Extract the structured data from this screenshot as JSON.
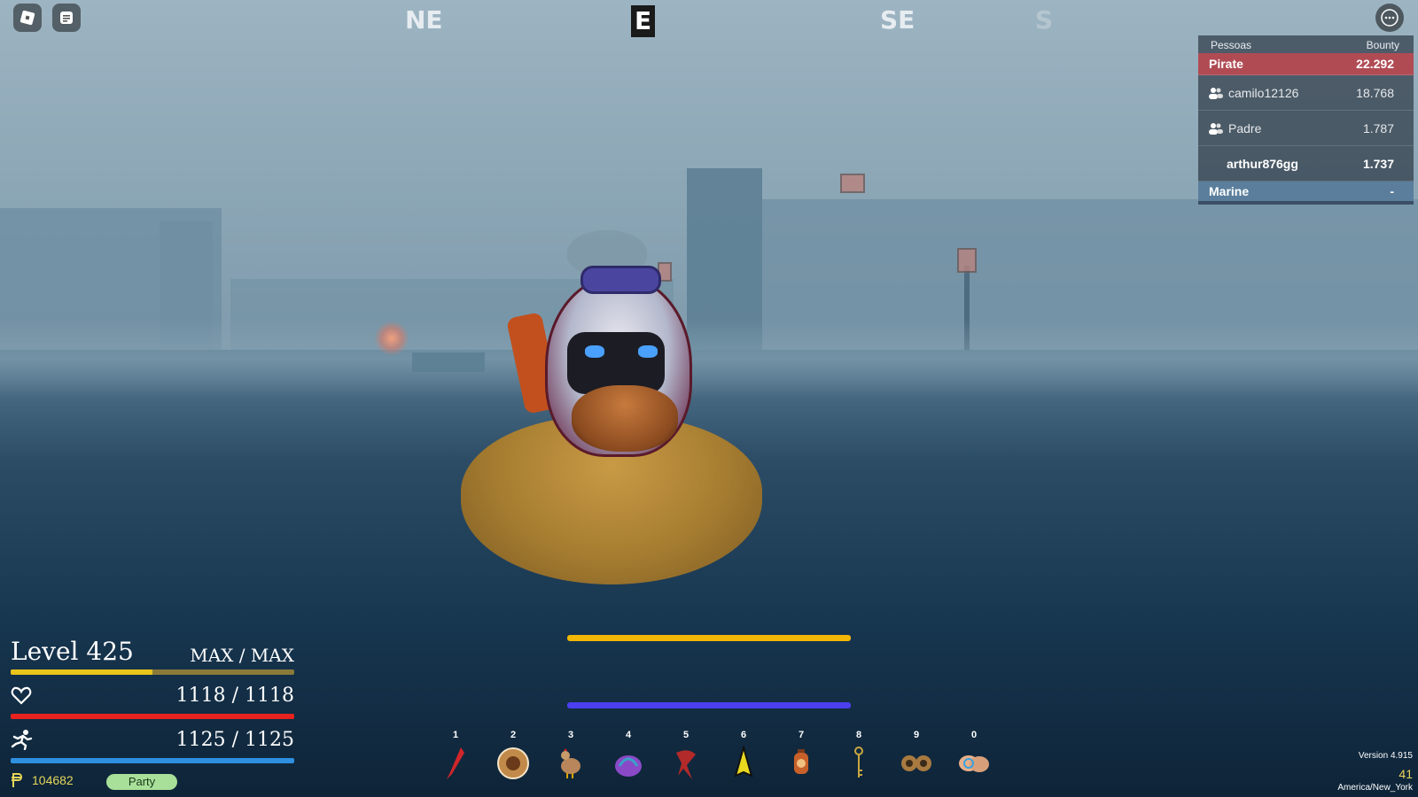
{
  "compass": {
    "left": "NE",
    "center": "E",
    "right": "SE",
    "far_right": "S"
  },
  "leaderboard": {
    "col_name": "Pessoas",
    "col_bounty": "Bounty",
    "pirate_team": {
      "label": "Pirate",
      "value": "22.292"
    },
    "players": [
      {
        "name": "camilo12126",
        "bounty": "18.768"
      },
      {
        "name": "Padre",
        "bounty": "1.787"
      },
      {
        "name": "arthur876gg",
        "bounty": "1.737"
      }
    ],
    "marine_team": {
      "label": "Marine",
      "value": "-"
    }
  },
  "stats": {
    "level": "Level 425",
    "exp": "MAX / MAX",
    "health": "1118 / 1118",
    "energy": "1125 / 1125",
    "exp_fill": 0.5,
    "health_fill": 1.0,
    "energy_fill": 1.0
  },
  "beli": "104682",
  "party_label": "Party",
  "hotbar": [
    {
      "key": "1",
      "icon": "red-blade-icon"
    },
    {
      "key": "2",
      "icon": "fighter-portrait-icon"
    },
    {
      "key": "3",
      "icon": "chicken-icon"
    },
    {
      "key": "4",
      "icon": "purple-fruit-icon"
    },
    {
      "key": "5",
      "icon": "red-whip-icon"
    },
    {
      "key": "6",
      "icon": "yellow-flame-icon"
    },
    {
      "key": "7",
      "icon": "lantern-icon"
    },
    {
      "key": "8",
      "icon": "gold-key-icon"
    },
    {
      "key": "9",
      "icon": "goggles-icon"
    },
    {
      "key": "0",
      "icon": "hands-icon"
    }
  ],
  "version": "Version 4.915",
  "fps": "41",
  "timezone": "America/New_York",
  "colors": {
    "pirate": "#b04b54",
    "marine": "#5a7e9c",
    "exp_bar": "#e9c41a",
    "health_bar": "#e8221e",
    "energy_bar": "#2f8fe0",
    "center_top_bar": "#f2b705",
    "center_bottom_bar": "#4b3ff0"
  }
}
